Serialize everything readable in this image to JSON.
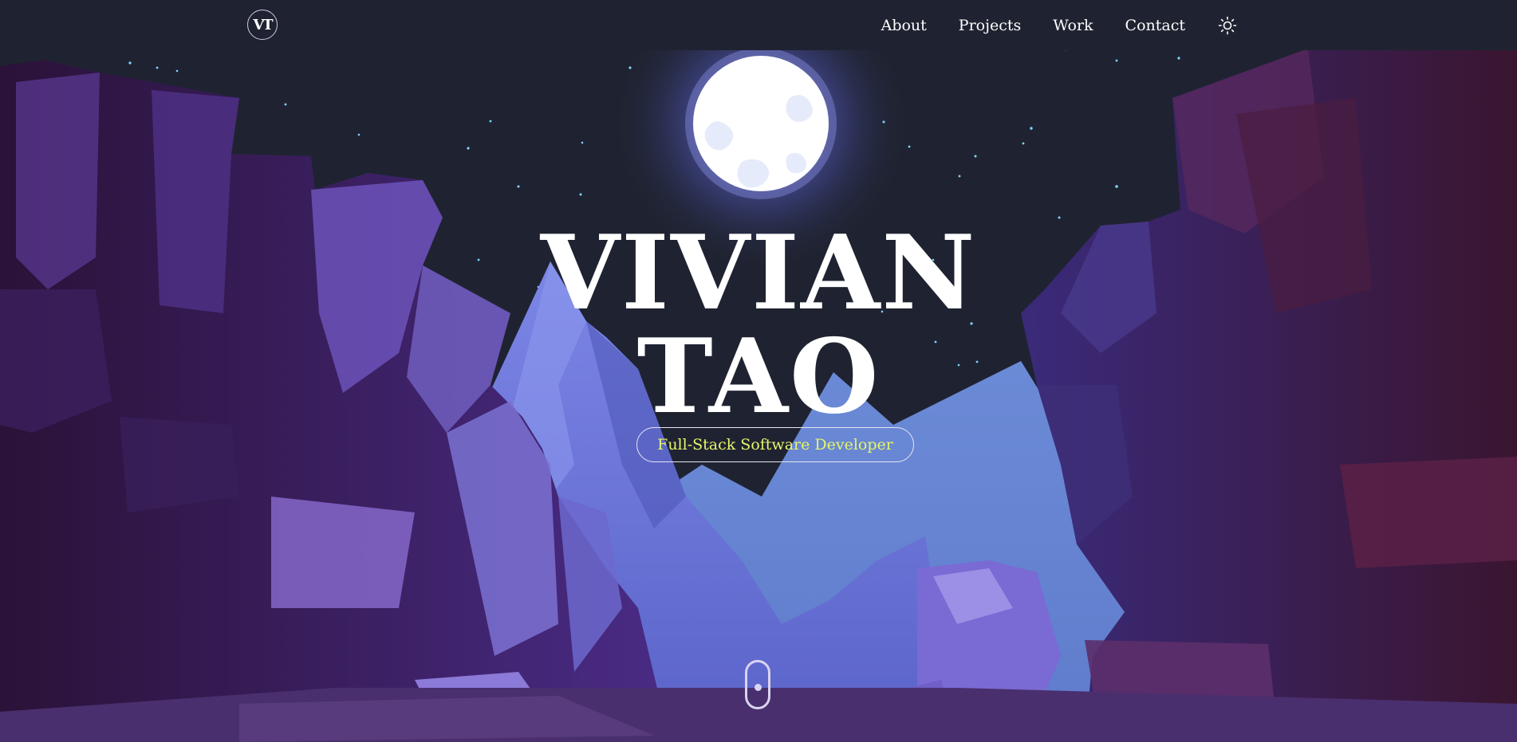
{
  "header": {
    "logo_text": "VT",
    "nav": [
      "About",
      "Projects",
      "Work",
      "Contact"
    ],
    "theme_icon": "sun-icon"
  },
  "hero": {
    "first_name": "VIVIAN",
    "last_name": "TAO",
    "tagline": "Full-Stack Software Developer",
    "scroll_icon": "mouse-scroll-icon"
  },
  "colors": {
    "sky": "#1f2331",
    "moon": "#ffffff",
    "accent_text": "#e6f56b",
    "cliffs_dark": "#2a1438",
    "cliffs_purple": "#5b3a9a",
    "mountains": "#6f7bd6"
  }
}
